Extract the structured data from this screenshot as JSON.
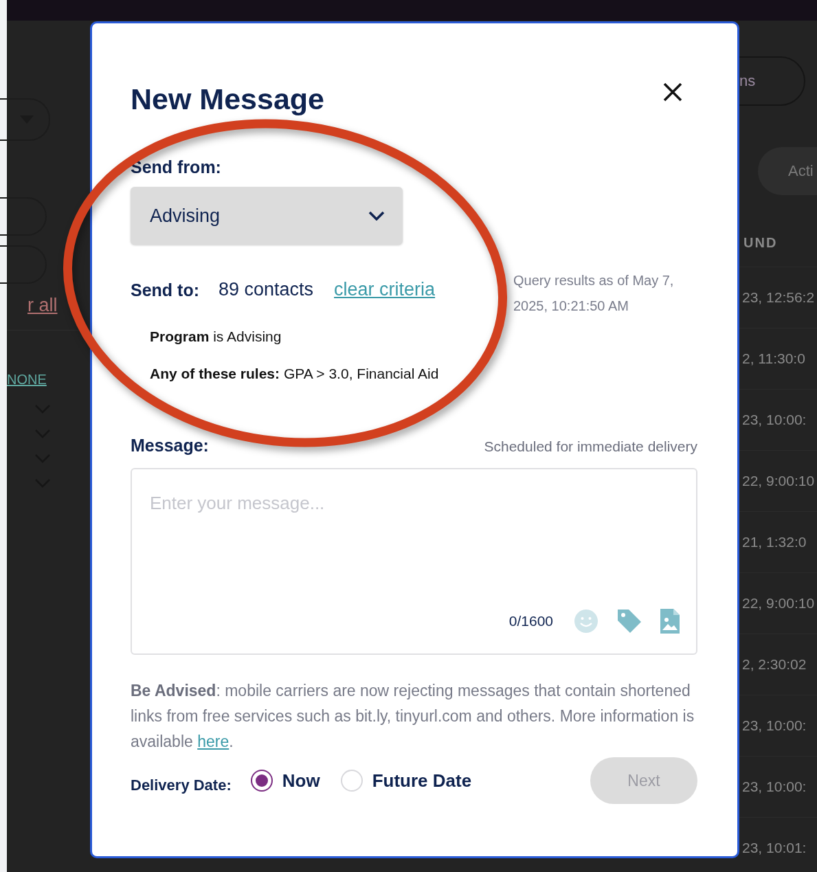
{
  "background": {
    "top_button": "ns",
    "action_button": "Acti",
    "left_links": [
      {
        "label": "r all",
        "kind": "clear"
      },
      {
        "label": "NONE",
        "kind": "none"
      }
    ],
    "column_header": "UND",
    "column_cells": [
      "23, 12:56:2",
      "2, 11:30:0",
      "23, 10:00:",
      "22, 9:00:10",
      "21, 1:32:0",
      "22, 9:00:10",
      "2, 2:30:02",
      "23, 10:00:",
      "23, 10:00:",
      "23, 10:01:"
    ]
  },
  "modal": {
    "title": "New Message",
    "send_from": {
      "label": "Send from:",
      "value": "Advising"
    },
    "send_to": {
      "label": "Send to:",
      "count": "89 contacts",
      "link": "clear criteria"
    },
    "query_note": "Query results as of May 7, 2025, 10:21:50 AM",
    "criteria": [
      "**Program** is Advising",
      "**Any of these rules:** GPA > 3.0, Financial Aid"
    ],
    "message": {
      "label": "Message:",
      "schedule_note": "Scheduled for immediate delivery",
      "placeholder": "Enter your message...",
      "counter": "0/1600"
    },
    "advisory": {
      "text": "**Be Advised**: mobile carriers are now rejecting messages that contain shortened links from free services such as bit.ly, tinyurl.com and others. More information is available ",
      "link": "here",
      "end": "."
    },
    "delivery": {
      "label": "Delivery Date:",
      "options": [
        {
          "label": "Now",
          "selected": true
        },
        {
          "label": "Future Date",
          "selected": false
        }
      ]
    },
    "next_button": {
      "label": "Next",
      "disabled": true
    }
  }
}
